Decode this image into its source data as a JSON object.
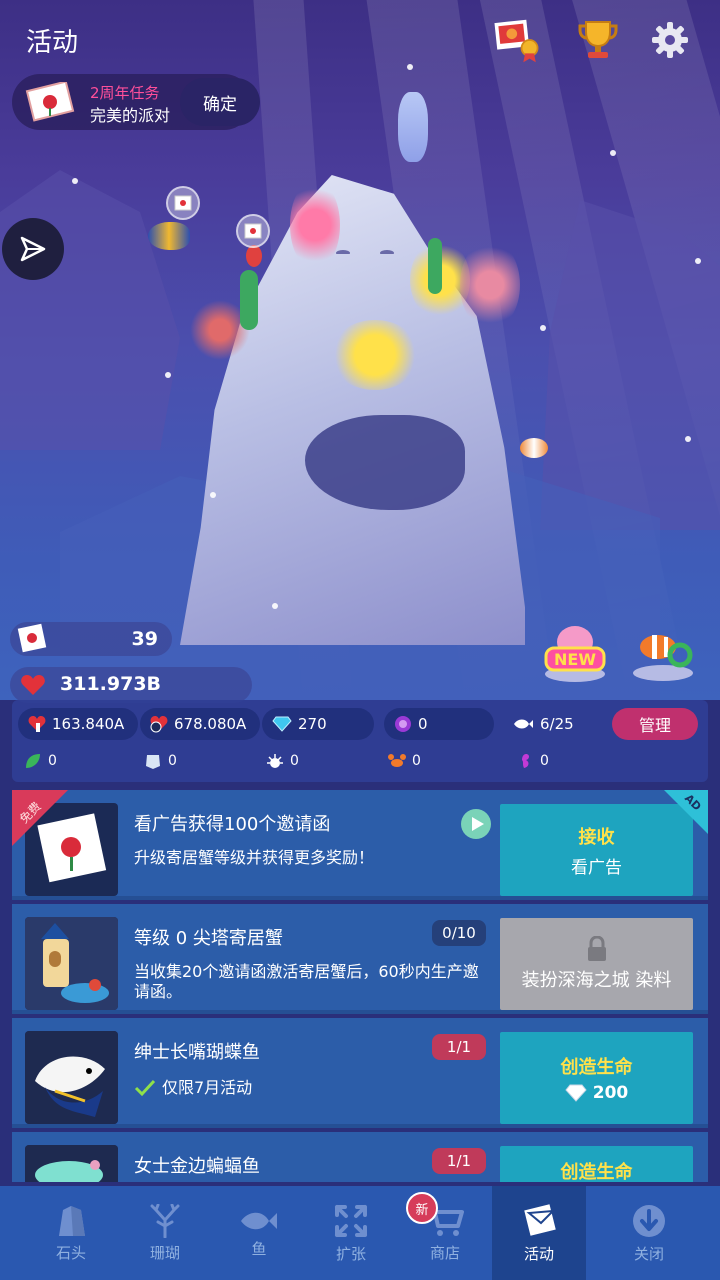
{
  "header": {
    "title": "活动"
  },
  "quest": {
    "line1": "2周年任务",
    "line2": "完美的派对",
    "button": "确定"
  },
  "currency": {
    "invites": "39",
    "hearts_total": "311.973B"
  },
  "stats": {
    "tap_rate": "163.840A",
    "heart_rate": "678.080A",
    "gems": "270",
    "orbs": "0",
    "fish": "6/25",
    "manage_label": "管理",
    "leaf": "0",
    "shell": "0",
    "urchin": "0",
    "crab": "0",
    "seahorse": "0"
  },
  "rows": [
    {
      "badge": "免费",
      "title": "看广告获得100个邀请函",
      "desc": "升级寄居蟹等级并获得更多奖励！",
      "action_label": "接收",
      "action_sub": "看广告",
      "ad_tag": "AD"
    },
    {
      "title": "等级 0 尖塔寄居蟹",
      "counter": "0/10",
      "desc": "当收集20个邀请函激活寄居蟹后，60秒内生产邀请函。",
      "action_label": "装扮深海之城 染料"
    },
    {
      "title": "绅士长嘴瑚蝶鱼",
      "counter": "1/1",
      "desc": "仅限7月活动",
      "action_label": "创造生命",
      "action_cost": "200"
    },
    {
      "title": "女士金边蝙蝠鱼",
      "counter": "1/1",
      "action_label": "创造生命"
    }
  ],
  "nav": [
    {
      "label": "石头",
      "icon": "stone-icon"
    },
    {
      "label": "珊瑚",
      "icon": "coral-icon"
    },
    {
      "label": "鱼",
      "icon": "fish-icon"
    },
    {
      "label": "扩张",
      "icon": "expand-icon"
    },
    {
      "label": "商店",
      "icon": "cart-icon",
      "badge": "新"
    },
    {
      "label": "活动",
      "icon": "event-icon"
    },
    {
      "label": "关闭",
      "icon": "close-down-icon"
    }
  ]
}
